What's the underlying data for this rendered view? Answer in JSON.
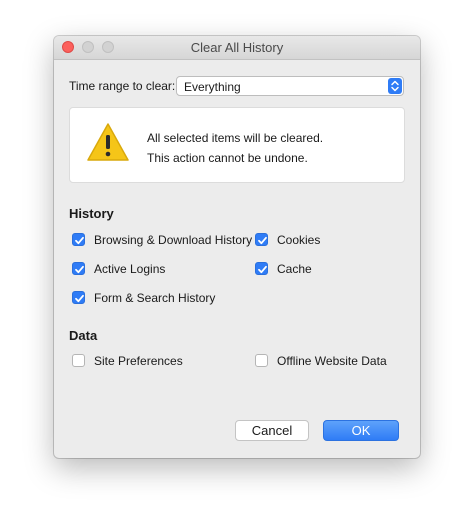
{
  "window": {
    "title": "Clear All History"
  },
  "time_range": {
    "label": "Time range to clear:",
    "selected": "Everything"
  },
  "warning": {
    "line1": "All selected items will be cleared.",
    "line2": "This action cannot be undone."
  },
  "history": {
    "title": "History",
    "items": [
      {
        "label": "Browsing & Download History",
        "checked": true
      },
      {
        "label": "Cookies",
        "checked": true
      },
      {
        "label": "Active Logins",
        "checked": true
      },
      {
        "label": "Cache",
        "checked": true
      },
      {
        "label": "Form & Search History",
        "checked": true
      }
    ]
  },
  "data_section": {
    "title": "Data",
    "items": [
      {
        "label": "Site Preferences",
        "checked": false
      },
      {
        "label": "Offline Website Data",
        "checked": false
      }
    ]
  },
  "buttons": {
    "cancel": "Cancel",
    "ok": "OK"
  },
  "colors": {
    "accent": "#2f7cf6",
    "close": "#fc605c",
    "warning": "#f5c518"
  },
  "icons": {
    "warning": "warning-triangle-icon",
    "select": "chevron-up-down-icon",
    "check": "checkmark-icon"
  }
}
